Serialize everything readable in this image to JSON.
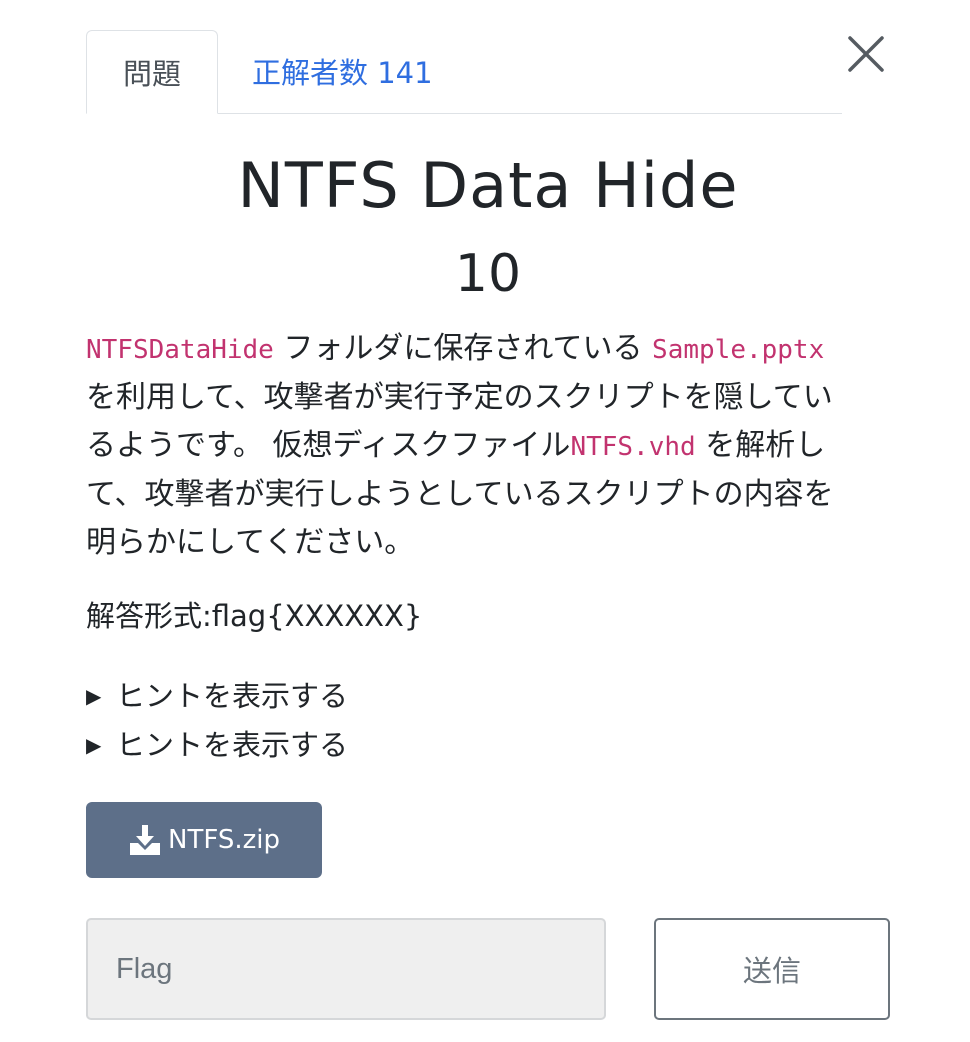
{
  "tabs": {
    "problem_label": "問題",
    "solvers_label": "正解者数 141"
  },
  "challenge": {
    "title": "NTFS Data Hide",
    "points": "10",
    "description": {
      "code_folder": "NTFSDataHide",
      "text_1": "フォルダに保存されている",
      "code_file": "Sample.pptx",
      "text_2": "を利用して、攻撃者が実行予定のスクリプトを隠してい",
      "text_3": "るようです。 仮想ディスクファイル",
      "code_vhd": "NTFS.vhd",
      "text_4": "を解析し",
      "text_5": "て、攻撃者が実行しようとしているスクリプトの内容を",
      "text_6": "明らかにしてください。"
    },
    "answer_format": "解答形式:flag{XXXXXX}",
    "hints": [
      {
        "label": "ヒントを表示する"
      },
      {
        "label": "ヒントを表示する"
      }
    ],
    "download": {
      "label": "NTFS.zip"
    }
  },
  "submission": {
    "flag_placeholder": "Flag",
    "flag_value": "",
    "submit_label": "送信"
  },
  "icons": {
    "close": "close-icon",
    "download": "download-icon",
    "hint_toggle": "triangle-right-icon"
  },
  "colors": {
    "link": "#2f6ee0",
    "code": "#c2336f",
    "download_button": "#5d6f89",
    "input_background": "#efefef"
  }
}
